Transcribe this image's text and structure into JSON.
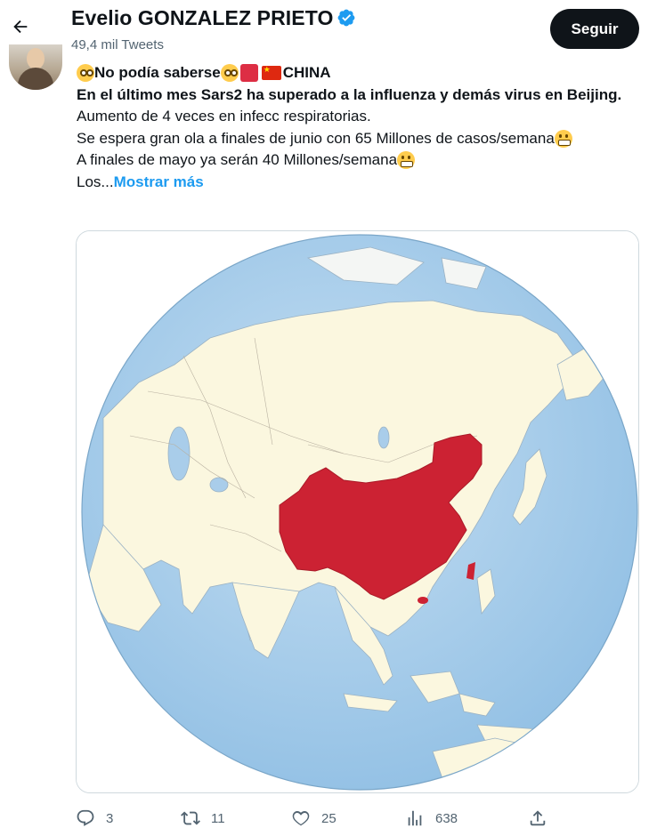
{
  "header": {
    "name": "Evelio GONZALEZ PRIETO",
    "tweets_count": "49,4 mil Tweets",
    "follow_label": "Seguir"
  },
  "icons": {
    "back": "arrow-left-icon",
    "verified": "verified-badge-icon",
    "reply": "reply-icon",
    "retweet": "retweet-icon",
    "like": "heart-icon",
    "views": "views-icon",
    "share": "share-icon"
  },
  "tweet": {
    "line1_a": "No podía saberse",
    "line1_b": "CHINA",
    "line2": "En el último mes Sars2 ha superado a la influenza y demás virus en Beijing.",
    "line3": "Aumento de 4 veces en infecc respiratorias.",
    "line4": "Se espera gran ola a finales de junio con 65 Millones de casos/semana",
    "line5": "A finales de mayo ya serán 40 Millones/semana",
    "line6": "Los...",
    "show_more": "Mostrar más"
  },
  "stats": {
    "replies": "3",
    "retweets": "11",
    "likes": "25",
    "views": "638"
  },
  "colors": {
    "accent": "#1d9bf0",
    "follow_bg": "#0f1419",
    "ocean": "#a9cdea",
    "land": "#fdfbe8",
    "highlight": "#cc2233"
  }
}
